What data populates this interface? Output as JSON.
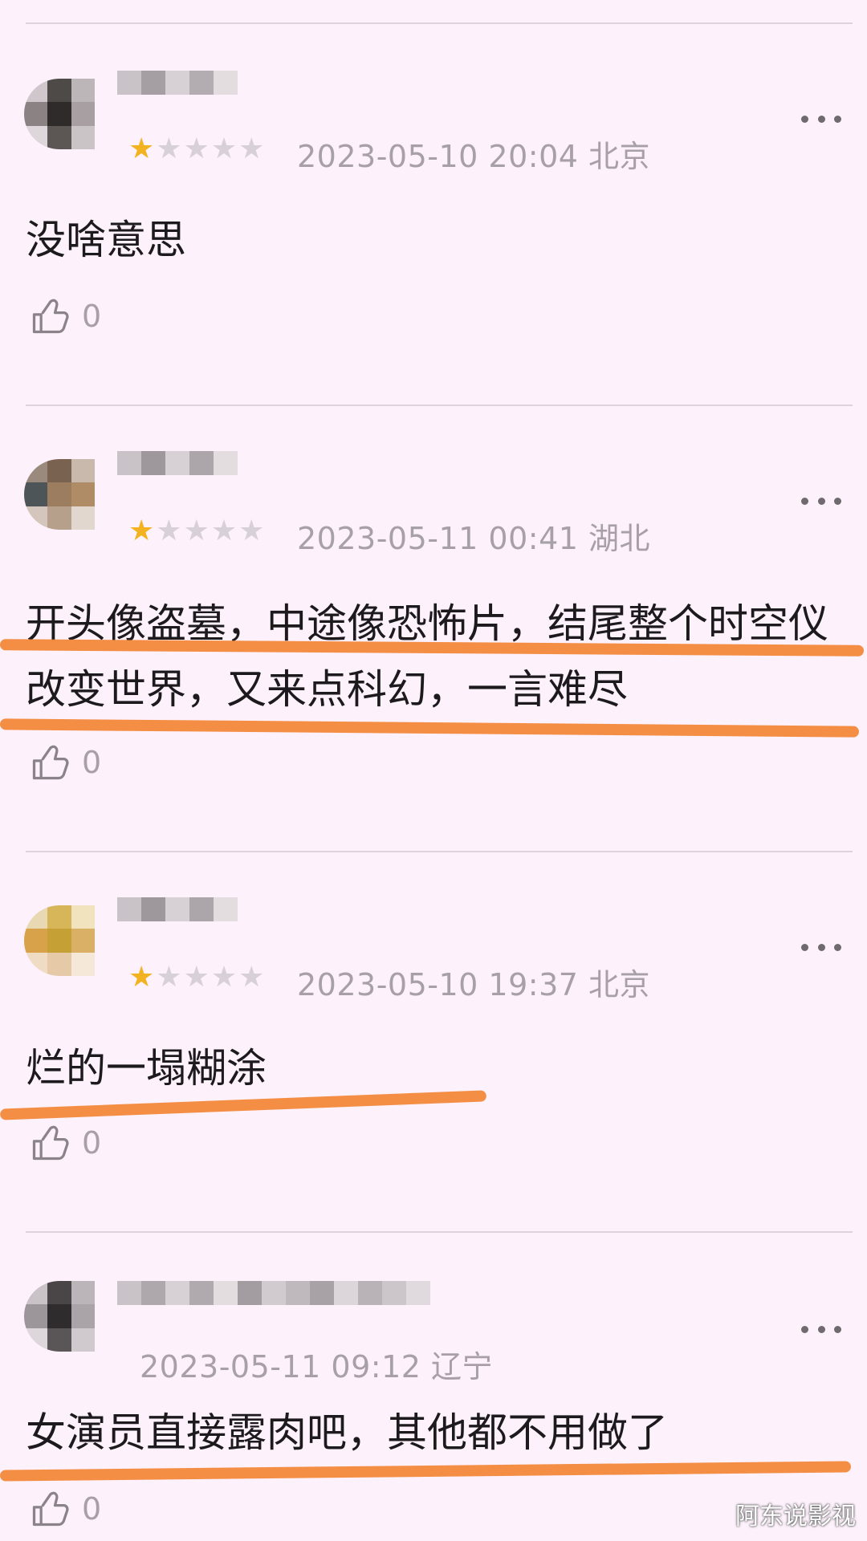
{
  "colors": {
    "background": "#fdf1fb",
    "star_on": "#f3b321",
    "star_off": "#d8d0d8",
    "meta_text": "#a8a0a8",
    "highlight": "#f2883a"
  },
  "icons": {
    "more": "more-icon",
    "like": "thumbs-up-icon",
    "star": "star-icon"
  },
  "comments": [
    {
      "rating": 1,
      "date": "2023-05-10 20:04",
      "location": "北京",
      "text": "没啥意思",
      "likes": "0"
    },
    {
      "rating": 1,
      "date": "2023-05-11 00:41",
      "location": "湖北",
      "text": "开头像盗墓，中途像恐怖片，结尾整个时空仪改变世界，又来点科幻，一言难尽",
      "likes": "0"
    },
    {
      "rating": 1,
      "date": "2023-05-10 19:37",
      "location": "北京",
      "text": "烂的一塌糊涂",
      "likes": "0"
    },
    {
      "rating": null,
      "date": "2023-05-11 09:12",
      "location": "辽宁",
      "text": "女演员直接露肉吧，其他都不用做了",
      "likes": "0"
    }
  ],
  "watermark": "阿东说影视"
}
